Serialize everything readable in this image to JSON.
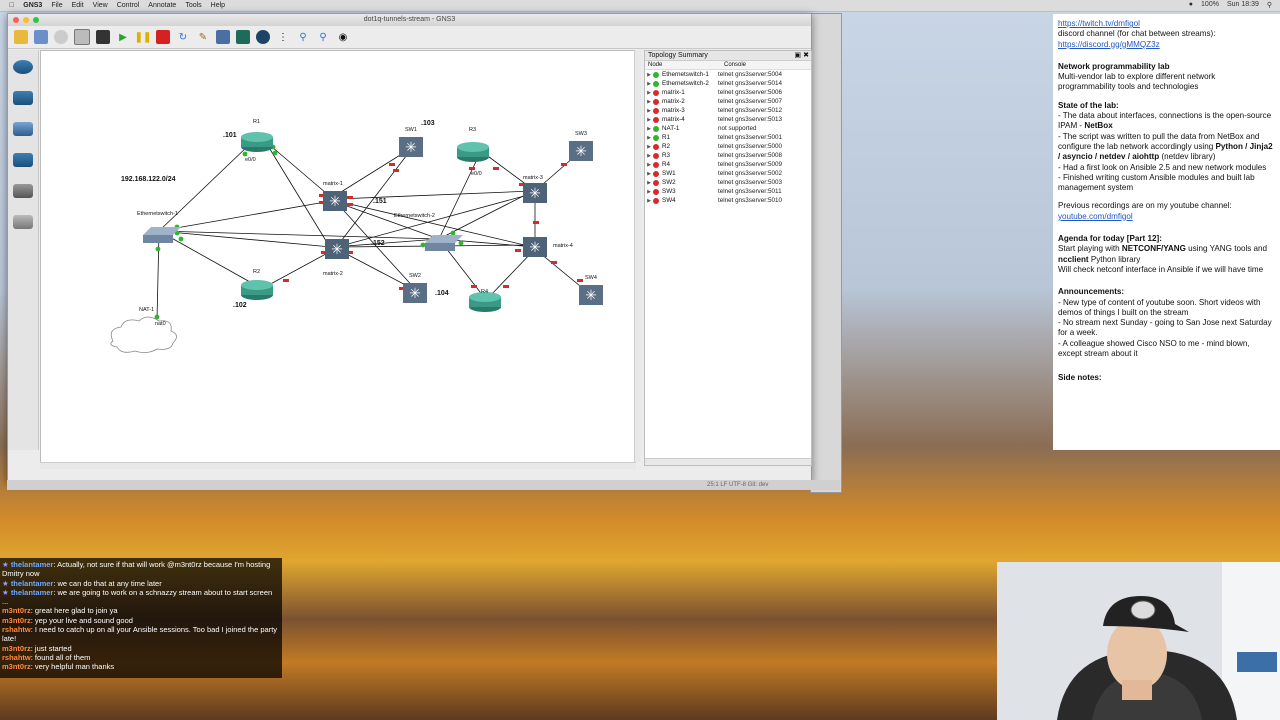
{
  "menubar": {
    "app": "GNS3",
    "items": [
      "File",
      "Edit",
      "View",
      "Control",
      "Annotate",
      "Tools",
      "Help"
    ],
    "right_status": [
      "100%",
      "Sun 18:39"
    ]
  },
  "window": {
    "title": "dot1q-tunnels-stream - GNS3"
  },
  "topology": {
    "title": "Topology Summary",
    "col_node": "Node",
    "col_console": "Console",
    "rows": [
      {
        "node": "Ethernetswitch-1",
        "console": "telnet gns3server:5004",
        "color": "#2fb52f"
      },
      {
        "node": "Ethernetswitch-2",
        "console": "telnet gns3server:5014",
        "color": "#2fb52f"
      },
      {
        "node": "matrix-1",
        "console": "telnet gns3server:5006",
        "color": "#d62b2b"
      },
      {
        "node": "matrix-2",
        "console": "telnet gns3server:5007",
        "color": "#d62b2b"
      },
      {
        "node": "matrix-3",
        "console": "telnet gns3server:5012",
        "color": "#d62b2b"
      },
      {
        "node": "matrix-4",
        "console": "telnet gns3server:5013",
        "color": "#d62b2b"
      },
      {
        "node": "NAT-1",
        "console": "not supported",
        "color": "#2fb52f"
      },
      {
        "node": "R1",
        "console": "telnet gns3server:5001",
        "color": "#2fb52f"
      },
      {
        "node": "R2",
        "console": "telnet gns3server:5000",
        "color": "#d62b2b"
      },
      {
        "node": "R3",
        "console": "telnet gns3server:5008",
        "color": "#d62b2b"
      },
      {
        "node": "R4",
        "console": "telnet gns3server:5009",
        "color": "#d62b2b"
      },
      {
        "node": "SW1",
        "console": "telnet gns3server:5002",
        "color": "#d62b2b"
      },
      {
        "node": "SW2",
        "console": "telnet gns3server:5003",
        "color": "#d62b2b"
      },
      {
        "node": "SW3",
        "console": "telnet gns3server:5011",
        "color": "#d62b2b"
      },
      {
        "node": "SW4",
        "console": "telnet gns3server:5010",
        "color": "#d62b2b"
      }
    ]
  },
  "diagram": {
    "subnet": "192.168.122.0/24",
    "ip_101": ".101",
    "ip_102": ".102",
    "ip_103": ".103",
    "ip_104": ".104",
    "ip_151": ".151",
    "ip_152": ".152",
    "labels": {
      "r1": "R1",
      "r2": "R2",
      "r3": "R3",
      "r4": "R4",
      "sw1": "SW1",
      "sw2": "SW2",
      "sw3": "SW3",
      "sw4": "SW4",
      "m1": "matrix-1",
      "m2": "matrix-2",
      "m3": "matrix-3",
      "m4": "matrix-4",
      "es1": "Ethernetswitch-1",
      "es2": "Ethernetswitch-2",
      "nat": "NAT-1",
      "nat_if": "nat0",
      "e00": "e0/0"
    }
  },
  "statusbar": {
    "text": "25:1  LF  UTF-8  Git: dev"
  },
  "notes": {
    "twitch": "https://twitch.tv/dmfigol",
    "discord_label": "discord channel (for chat between streams):",
    "discord": "https://discord.gg/gMMQZ3z",
    "lab_title": "Network programmability lab",
    "lab_desc": "Multi-vendor lab to explore different network programmability tools and technologies",
    "state_title": "State of the lab:",
    "state_1a": "- The data about interfaces, connections is the open-source IPAM - ",
    "state_1b": "NetBox",
    "state_2a": "- The script was written to pull the data from NetBox and configure the lab network accordingly using ",
    "state_2b": "Python / Jinja2 / asyncio / netdev / aiohttp",
    "state_2c": " (netdev library)",
    "state_3": "- Had a first look on Ansible 2.5 and new network modules",
    "state_4": "- Finished writing custom Ansible modules and built lab management system",
    "prev_label": "Previous recordings are on my youtube channel:",
    "prev_link": "youtube.com/dmfigol",
    "agenda_title": "Agenda for today [Part 12]:",
    "agenda_1a": "Start playing with ",
    "agenda_1b": "NETCONF/YANG",
    "agenda_1c": " using YANG tools and ",
    "agenda_1d": "ncclient",
    "agenda_1e": " Python library",
    "agenda_2": "Will check netconf interface in Ansible if we will have time",
    "ann_title": "Announcements:",
    "ann_1": "- New type of content of youtube soon. Short videos with demos of things I built on the stream",
    "ann_2": "- No stream next Sunday - going to San Jose next Saturday for a week.",
    "ann_3": "- A colleague showed Cisco NSO to me - mind blown, except stream about it",
    "side_title": "Side notes:"
  },
  "chat": [
    {
      "user": "thelantamer",
      "text": ": Actually, not sure if that will work @m3nt0rz because I'm hosting Dmitry now",
      "color": "#6ea9ff",
      "star": true
    },
    {
      "user": "thelantamer",
      "text": ": we can do that at any time later",
      "color": "#6ea9ff",
      "star": true
    },
    {
      "user": "thelantamer",
      "text": ": we are going to work on a schnazzy stream about to start screen ...",
      "color": "#6ea9ff",
      "star": true
    },
    {
      "user": "m3nt0rz",
      "text": ": great here glad to join ya",
      "color": "#ff8a3d",
      "star": false
    },
    {
      "user": "m3nt0rz",
      "text": ": yep your live and sound good",
      "color": "#ff8a3d",
      "star": false
    },
    {
      "user": "rshahtw",
      "text": ": I need to catch up on all your Ansible sessions. Too bad I joined the party late!",
      "color": "#ff8a3d",
      "star": false
    },
    {
      "user": "m3nt0rz",
      "text": ": just started",
      "color": "#ff8a3d",
      "star": false
    },
    {
      "user": "rshahtw",
      "text": ": found all of them",
      "color": "#ff8a3d",
      "star": false
    },
    {
      "user": "m3nt0rz",
      "text": ": very helpful man thanks",
      "color": "#ff8a3d",
      "star": false
    }
  ]
}
